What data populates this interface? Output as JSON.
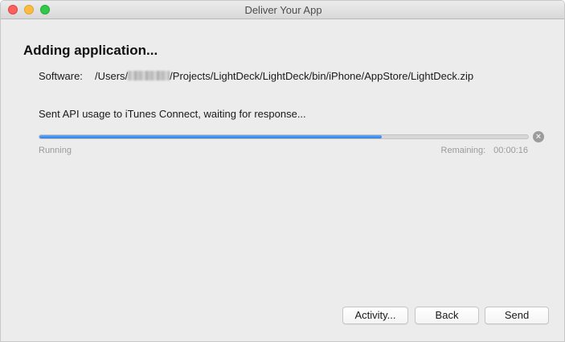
{
  "window": {
    "title": "Deliver Your App"
  },
  "heading": "Adding application...",
  "software": {
    "label": "Software:",
    "path_prefix": "/Users/",
    "path_suffix": "/Projects/LightDeck/LightDeck/bin/iPhone/AppStore/LightDeck.zip"
  },
  "status_message": "Sent API usage to iTunes Connect, waiting for response...",
  "progress": {
    "fraction": 0.7,
    "state": "Running",
    "remaining_label": "Remaining:",
    "remaining_time": "00:00:16",
    "cancel_glyph": "×",
    "fill_color": "#3a8ef0"
  },
  "buttons": {
    "activity": "Activity...",
    "back": "Back",
    "send": "Send"
  },
  "icons": {
    "close": "close-window-icon",
    "minimize": "minimize-window-icon",
    "maximize": "zoom-window-icon",
    "cancel": "cancel-progress-icon"
  }
}
